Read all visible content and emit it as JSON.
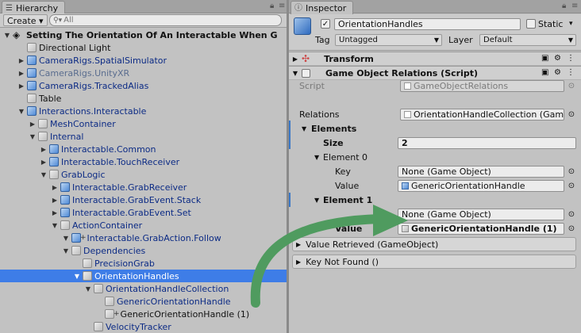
{
  "hierarchy": {
    "tab_label": "Hierarchy",
    "create_label": "Create",
    "search_placeholder": "All",
    "scene_name": "Setting The Orientation Of An Interactable When G",
    "items": [
      {
        "label": "Directional Light",
        "style": "plain",
        "icon": "cube-grey"
      },
      {
        "label": "CameraRigs.SpatialSimulator",
        "style": "blue",
        "icon": "cube-prefab"
      },
      {
        "label": "CameraRigs.UnityXR",
        "style": "dim",
        "icon": "cube-prefab"
      },
      {
        "label": "CameraRigs.TrackedAlias",
        "style": "blue",
        "icon": "cube-prefab"
      },
      {
        "label": "Table",
        "style": "plain",
        "icon": "cube-grey"
      },
      {
        "label": "Interactions.Interactable",
        "style": "blue",
        "icon": "cube-prefab"
      },
      {
        "label": "MeshContainer",
        "style": "blue",
        "icon": "cube-grey"
      },
      {
        "label": "Internal",
        "style": "blue",
        "icon": "cube-grey"
      },
      {
        "label": "Interactable.Common",
        "style": "blue",
        "icon": "cube-prefab"
      },
      {
        "label": "Interactable.TouchReceiver",
        "style": "blue",
        "icon": "cube-prefab"
      },
      {
        "label": "GrabLogic",
        "style": "blue",
        "icon": "cube-grey"
      },
      {
        "label": "Interactable.GrabReceiver",
        "style": "blue",
        "icon": "cube-prefab"
      },
      {
        "label": "Interactable.GrabEvent.Stack",
        "style": "blue",
        "icon": "cube-prefab"
      },
      {
        "label": "Interactable.GrabEvent.Set",
        "style": "blue",
        "icon": "cube-prefab"
      },
      {
        "label": "ActionContainer",
        "style": "blue",
        "icon": "cube-grey"
      },
      {
        "label": "Interactable.GrabAction.Follow",
        "style": "blue",
        "icon": "cube-prefab-plus"
      },
      {
        "label": "Dependencies",
        "style": "blue",
        "icon": "cube-grey"
      },
      {
        "label": "PrecisionGrab",
        "style": "blue",
        "icon": "cube-grey"
      },
      {
        "label": "OrientationHandles",
        "style": "selected",
        "icon": "cube-grey"
      },
      {
        "label": "OrientationHandleCollection",
        "style": "blue",
        "icon": "cube-grey"
      },
      {
        "label": "GenericOrientationHandle",
        "style": "blue",
        "icon": "cube-grey"
      },
      {
        "label": "GenericOrientationHandle (1)",
        "style": "plain",
        "icon": "cube-grey-plus"
      },
      {
        "label": "VelocityTracker",
        "style": "blue",
        "icon": "cube-grey"
      }
    ]
  },
  "inspector": {
    "tab_label": "Inspector",
    "object_name": "OrientationHandles",
    "static_label": "Static",
    "tag_label": "Tag",
    "tag_value": "Untagged",
    "layer_label": "Layer",
    "layer_value": "Default",
    "transform_title": "Transform",
    "component_title": "Game Object Relations (Script)",
    "script_label": "Script",
    "script_value": "GameObjectRelations",
    "relations_label": "Relations",
    "relations_value": "OrientationHandleCollection (Gam",
    "elements_label": "Elements",
    "size_label": "Size",
    "size_value": "2",
    "element0_label": "Element 0",
    "key_label": "Key",
    "key0_value": "None (Game Object)",
    "value_label": "Value",
    "value0_value": "GenericOrientationHandle",
    "element1_label": "Element 1",
    "key1_value": "None (Game Object)",
    "value1_label": "Value",
    "value1_value": "GenericOrientationHandle (1)",
    "event1": "Value Retrieved (GameObject)",
    "event2": "Key Not Found ()"
  },
  "colors": {
    "selection": "#3e7de7",
    "arrow": "#4f9b5f"
  }
}
